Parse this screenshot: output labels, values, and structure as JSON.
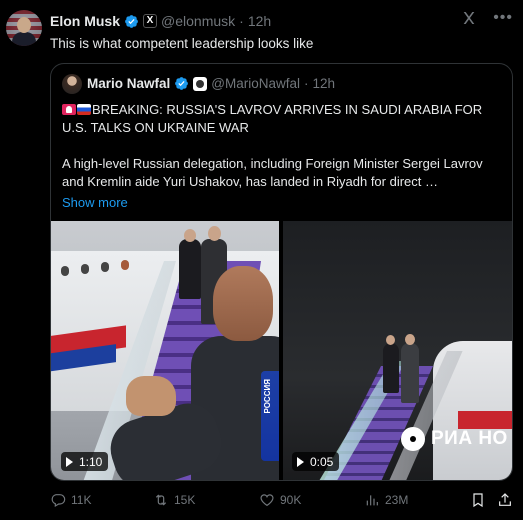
{
  "post": {
    "author_name": "Elon Musk",
    "author_handle": "@elonmusk",
    "separator": "·",
    "time": "12h",
    "affiliation_badge": "X",
    "text": "This is what competent leadership looks like"
  },
  "quote": {
    "author_name": "Mario Nawfal",
    "author_handle": "@MarioNawfal",
    "separator": "·",
    "time": "12h",
    "headline": "BREAKING: RUSSIA'S LAVROV ARRIVES IN SAUDI ARABIA FOR U.S. TALKS ON UKRAINE WAR",
    "body": "A high-level Russian delegation, including Foreign Minister Sergei Lavrov and Kremlin aide Yuri Ushakov, has landed in Riyadh for direct …",
    "show_more": "Show more",
    "media": [
      {
        "duration": "1:10"
      },
      {
        "duration": "0:05",
        "watermark": "РИА НО"
      }
    ],
    "mic_text": "РОССИЯ"
  },
  "actions": {
    "replies": "11K",
    "reposts": "15K",
    "likes": "90K",
    "views": "23M"
  },
  "colors": {
    "background": "#000000",
    "text": "#e7e9ea",
    "muted": "#71767b",
    "accent": "#1d9bf0",
    "border": "#2f3336"
  },
  "icons": [
    "verified-badge-icon",
    "grok-icon",
    "more-icon",
    "reply-icon",
    "repost-icon",
    "like-icon",
    "views-icon",
    "bookmark-icon",
    "share-icon",
    "play-icon"
  ]
}
